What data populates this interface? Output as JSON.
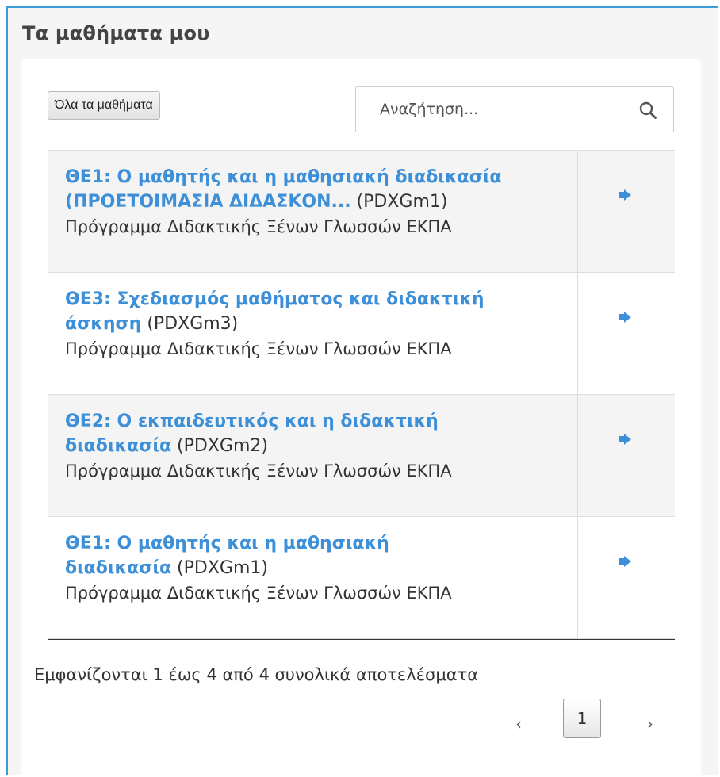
{
  "panel": {
    "title": "Τα μαθήματα μου"
  },
  "toolbar": {
    "all_courses_label": "Όλα τα μαθήματα",
    "search_placeholder": "Αναζήτηση...",
    "search_value": "",
    "search_icon": "search-icon"
  },
  "courses": [
    {
      "title_line1": "ΘΕ1: Ο μαθητής και η μαθησιακή διαδικασία",
      "title_line2": "(ΠΡΟΕΤΟΙΜΑΣΙΑ ΔΙΔΑΣΚΟΝ...",
      "code": " (PDXGm1)",
      "department": "Πρόγραμμα Διδακτικής Ξένων Γλωσσών ΕΚΠΑ",
      "action_icon": "enter-icon"
    },
    {
      "title_line1": "ΘΕ3: Σχεδιασμός μαθήματος και διδακτική",
      "title_line2": "άσκηση",
      "code": " (PDXGm3)",
      "department": "Πρόγραμμα Διδακτικής Ξένων Γλωσσών ΕΚΠΑ",
      "action_icon": "enter-icon"
    },
    {
      "title_line1": "ΘΕ2: Ο εκπαιδευτικός και η διδακτική",
      "title_line2": "διαδικασία",
      "code": " (PDXGm2)",
      "department": "Πρόγραμμα Διδακτικής Ξένων Γλωσσών ΕΚΠΑ",
      "action_icon": "enter-icon"
    },
    {
      "title_line1": "ΘΕ1: Ο μαθητής και η μαθησιακή",
      "title_line2": "διαδικασία",
      "code": " (PDXGm1)",
      "department": "Πρόγραμμα Διδακτικής Ξένων Γλωσσών ΕΚΠΑ",
      "action_icon": "enter-icon"
    }
  ],
  "footer": {
    "summary": "Εμφανίζονται 1 έως 4 από 4 συνολικά αποτελέσματα",
    "prev": "‹",
    "page": "1",
    "next": "›"
  },
  "colors": {
    "accent": "#3a9bd5",
    "link": "#3d8fd8"
  }
}
